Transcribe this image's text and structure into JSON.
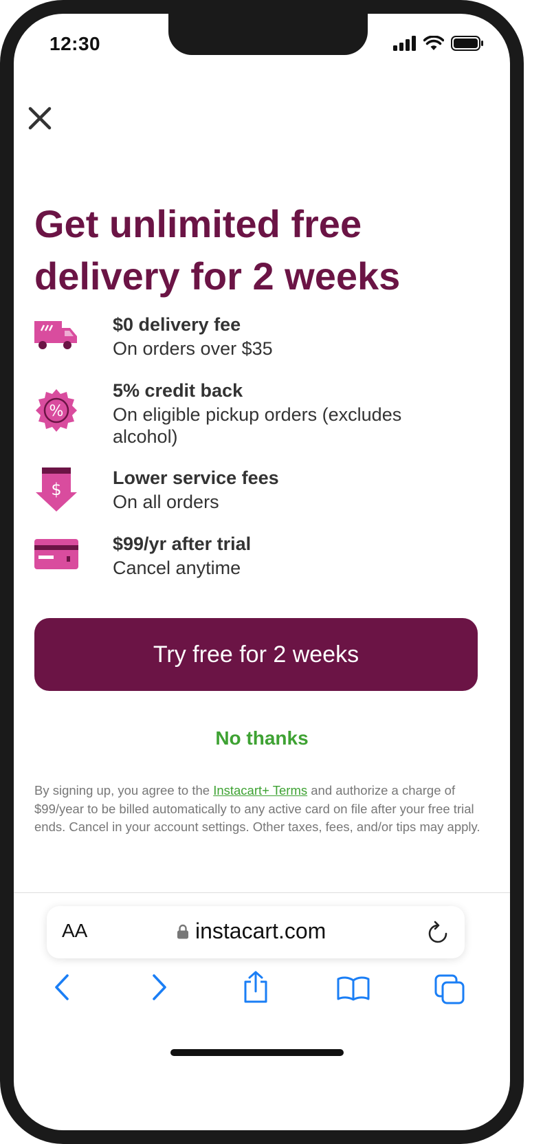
{
  "status_bar": {
    "time": "12:30"
  },
  "modal": {
    "headline": "Get unlimited free delivery for 2 weeks",
    "benefits": [
      {
        "icon": "truck-icon",
        "title": "$0 delivery fee",
        "subtitle": "On orders over $35"
      },
      {
        "icon": "percent-badge-icon",
        "title": "5% credit back",
        "subtitle": "On eligible pickup orders (excludes alcohol)"
      },
      {
        "icon": "dollar-down-arrow-icon",
        "title": "Lower service fees",
        "subtitle": "On all orders"
      },
      {
        "icon": "credit-card-icon",
        "title": "$99/yr after trial",
        "subtitle": "Cancel anytime"
      }
    ],
    "cta_label": "Try free for 2 weeks",
    "decline_label": "No thanks",
    "legal": {
      "prefix": "By signing up, you agree to the ",
      "link_text": "Instacart+ Terms",
      "suffix": " and authorize a charge of $99/year to be billed automatically to any active card on file after your free trial ends. Cancel in your account settings. Other taxes, fees, and/or tips may apply."
    }
  },
  "browser": {
    "text_size_label": "AA",
    "url": "instacart.com"
  },
  "colors": {
    "brand": "#6b1445",
    "accent_pink": "#d94c9e",
    "link_green": "#3ea233",
    "browser_blue": "#1a7ef5"
  }
}
